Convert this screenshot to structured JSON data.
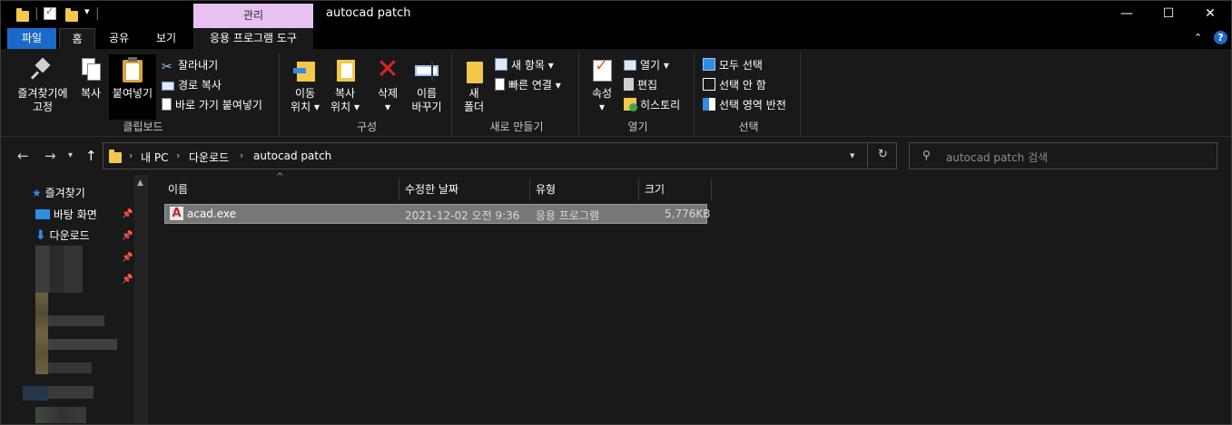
{
  "window": {
    "title": "autocad patch",
    "contextual_tab_header": "관리",
    "controls": {
      "minimize": "—",
      "maximize": "☐",
      "close": "✕"
    }
  },
  "ribbon_tabs": {
    "file": "파일",
    "home": "홈",
    "share": "공유",
    "view": "보기",
    "app_tools": "응용 프로그램 도구"
  },
  "ribbon": {
    "clipboard": {
      "label": "클립보드",
      "pin_quick_access_line1": "즐겨찾기에",
      "pin_quick_access_line2": "고정",
      "copy": "복사",
      "paste": "붙여넣기",
      "cut": "잘라내기",
      "copy_path": "경로 복사",
      "paste_shortcut": "바로 가기 붙여넣기"
    },
    "organize": {
      "label": "구성",
      "move_to_line1": "이동",
      "move_to_line2": "위치",
      "copy_to_line1": "복사",
      "copy_to_line2": "위치",
      "delete": "삭제",
      "rename_line1": "이름",
      "rename_line2": "바꾸기"
    },
    "new": {
      "label": "새로 만들기",
      "new_folder_line1": "새",
      "new_folder_line2": "폴더",
      "new_item": "새 항목",
      "easy_access": "빠른 연결"
    },
    "open": {
      "label": "열기",
      "properties": "속성",
      "open": "열기",
      "edit": "편집",
      "history": "히스토리"
    },
    "select": {
      "label": "선택",
      "select_all": "모두 선택",
      "select_none": "선택 안 함",
      "invert_selection": "선택 영역 반전"
    }
  },
  "address": {
    "crumbs": [
      "내 PC",
      "다운로드",
      "autocad patch"
    ],
    "search_placeholder": "autocad patch 검색"
  },
  "nav": {
    "quick_access": "즐겨찾기",
    "desktop": "바탕 화면",
    "downloads": "다운로드"
  },
  "columns": {
    "name": "이름",
    "date_modified": "수정한 날짜",
    "type": "유형",
    "size": "크기"
  },
  "files": [
    {
      "name": "acad.exe",
      "date_modified": "2021-12-02 오전 9:36",
      "type": "응용 프로그램",
      "size": "5,776KB"
    }
  ],
  "colors": {
    "background": "#191919",
    "file_tab": "#1b6ac9",
    "contextual_tab": "#e7c1f2",
    "folder": "#f2c94c",
    "selected_row": "#777777"
  }
}
